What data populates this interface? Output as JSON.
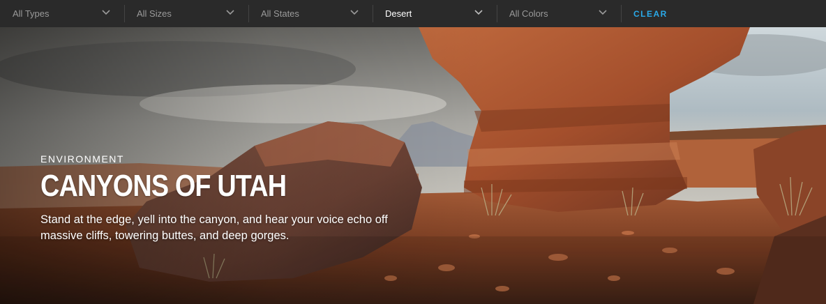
{
  "filters": [
    {
      "label": "All Types",
      "active": false
    },
    {
      "label": "All Sizes",
      "active": false
    },
    {
      "label": "All States",
      "active": false
    },
    {
      "label": "Desert",
      "active": true
    },
    {
      "label": "All Colors",
      "active": false
    }
  ],
  "clear_label": "CLEAR",
  "hero": {
    "category": "ENVIRONMENT",
    "title": "CANYONS OF UTAH",
    "description": "Stand at the edge, yell into the canyon, and hear your voice echo off massive cliffs, towering buttes, and deep gorges."
  },
  "colors": {
    "bar_bg": "#2a2a2a",
    "clear_accent": "#2aa9e8",
    "filter_text": "#9a9a9a",
    "filter_text_active": "#ffffff"
  },
  "icons": {
    "dropdown": "chevron-down-icon"
  }
}
